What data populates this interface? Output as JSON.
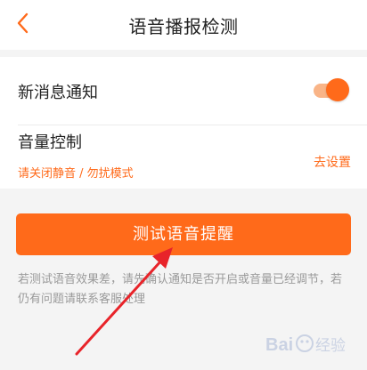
{
  "header": {
    "title": "语音播报检测",
    "back_icon": "chevron-left-icon"
  },
  "settings": {
    "notify": {
      "label": "新消息通知",
      "toggle_on": true
    },
    "volume": {
      "label": "音量控制",
      "hint": "请关闭静音 / 勿扰模式",
      "action": "去设置"
    }
  },
  "test_button": {
    "label": "测试语音提醒"
  },
  "note": {
    "text": "若测试语音效果差，请先确认通知是否开启或音量已经调节，若仍有问题请联系客服处理"
  },
  "watermark": {
    "text": "Baidu经验"
  },
  "colors": {
    "accent": "#ff6a1a",
    "toggle_track": "#f9b487",
    "background": "#f4f4f4",
    "note_text": "#9a9a9a",
    "arrow": "#e8242a"
  }
}
